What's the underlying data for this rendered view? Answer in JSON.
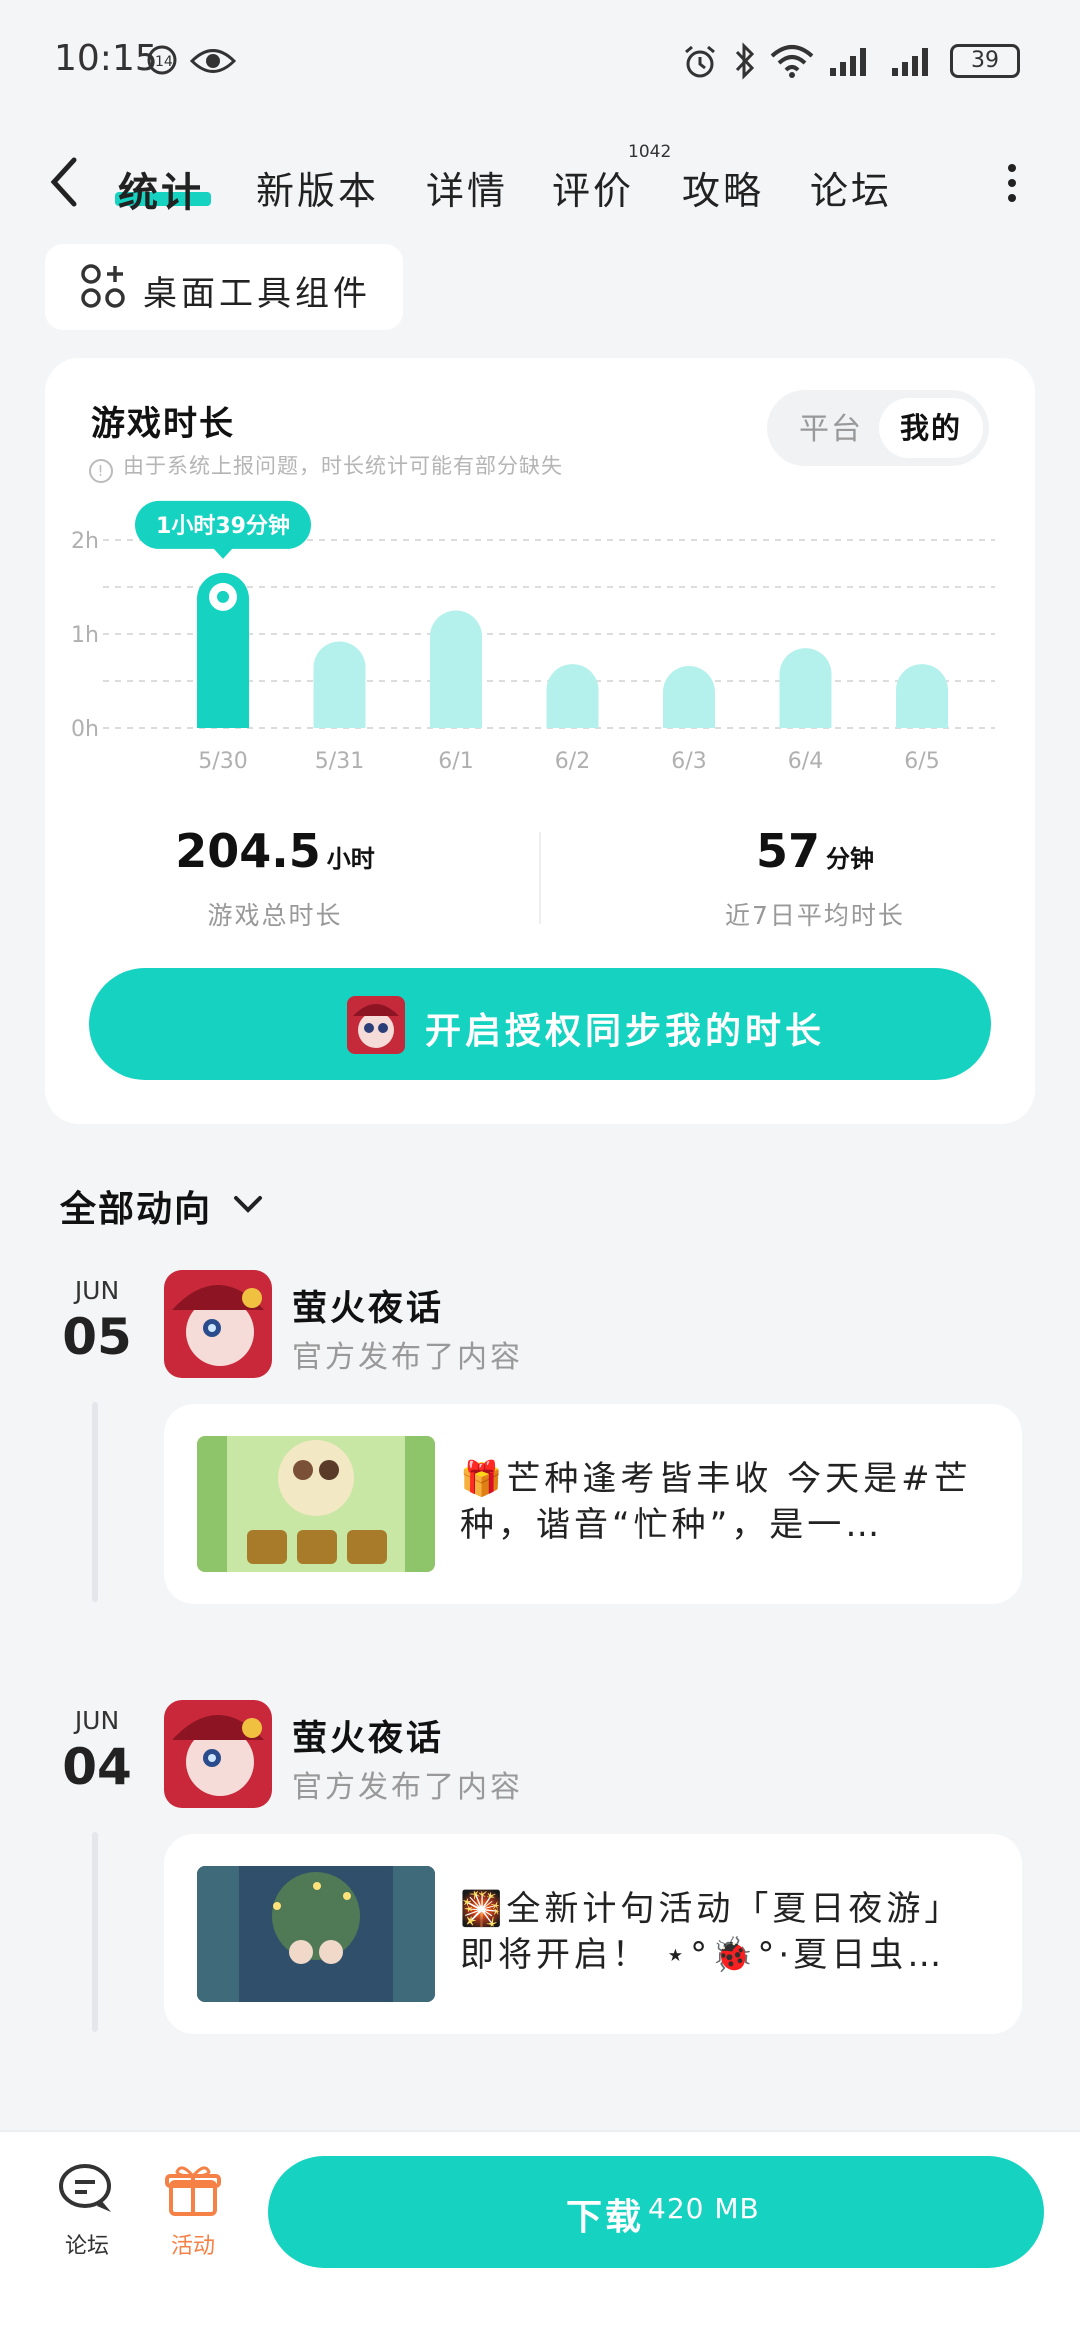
{
  "status_bar": {
    "time": "10:15",
    "battery": "39"
  },
  "tabs": [
    {
      "label": "统计"
    },
    {
      "label": "新版本"
    },
    {
      "label": "详情"
    },
    {
      "label": "评价",
      "badge": "1042"
    },
    {
      "label": "攻略"
    },
    {
      "label": "论坛"
    }
  ],
  "widget_button": {
    "label": "桌面工具组件"
  },
  "play_time": {
    "title": "游戏时长",
    "note": "由于系统上报问题，时长统计可能有部分缺失",
    "segment": {
      "platform": "平台",
      "mine": "我的"
    },
    "tooltip": "1小时39分钟",
    "total_value": "204.5",
    "total_unit": "小时",
    "total_caption": "游戏总时长",
    "avg_value": "57",
    "avg_unit": "分钟",
    "avg_caption": "近7日平均时长",
    "sync_button": "开启授权同步我的时长"
  },
  "chart_data": {
    "type": "bar",
    "categories": [
      "5/30",
      "5/31",
      "6/1",
      "6/2",
      "6/3",
      "6/4",
      "6/5"
    ],
    "values": [
      1.65,
      0.92,
      1.25,
      0.68,
      0.66,
      0.85,
      0.68
    ],
    "y_ticks": [
      "0h",
      "1h",
      "2h"
    ],
    "ylim": [
      0,
      2
    ],
    "highlight_index": 0,
    "colors": {
      "highlight": "#16d2c1",
      "normal": "#b5f1ec"
    },
    "grid": true
  },
  "feed": {
    "filter_label": "全部动向",
    "items": [
      {
        "month": "JUN",
        "day": "05",
        "publisher": "萤火夜话",
        "action": "官方发布了内容",
        "text": "🎁芒种逢考皆丰收 今天是#芒种，谐音“忙种”，是一…"
      },
      {
        "month": "JUN",
        "day": "04",
        "publisher": "萤火夜话",
        "action": "官方发布了内容",
        "text": "🎇全新计句活动「夏日夜游」即将开启！ ⋆°🐞°·夏日虫…"
      }
    ]
  },
  "bottom_bar": {
    "forum_label": "论坛",
    "activity_label": "活动",
    "download_label": "下载",
    "download_size": "420 MB"
  },
  "colors": {
    "accent": "#16d2c1",
    "activity": "#f58147"
  }
}
